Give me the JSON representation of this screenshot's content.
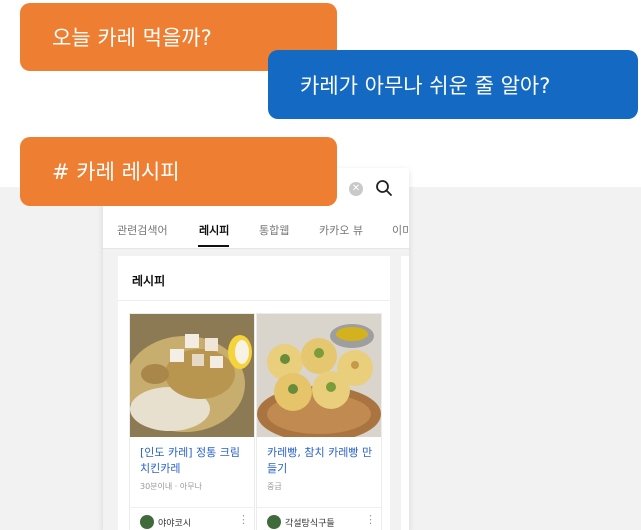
{
  "colors": {
    "orange_bubble": "#ee7e31",
    "blue_bubble": "#1469c2",
    "link_blue": "#2a62c8"
  },
  "bubbles": {
    "first": "오늘 카레 먹을까?",
    "second": "카레가 아무나 쉬운 줄 알아?",
    "third": "# 카레 레시피"
  },
  "search": {
    "clear_icon": "clear-icon",
    "search_icon": "search-icon"
  },
  "tabs": [
    {
      "label": "관련검색어"
    },
    {
      "label": "레시피",
      "active": true
    },
    {
      "label": "통합웹"
    },
    {
      "label": "카카오 뷰"
    },
    {
      "label": "이미"
    }
  ],
  "card": {
    "title": "레시피",
    "recipes": [
      {
        "title": "[인도 카레] 정통 크림 치킨카레",
        "meta": "30분이내 · 아무나",
        "author": "야야코시",
        "image": "chicken-curry-image"
      },
      {
        "title": "카레빵, 참치 카레빵 만들기",
        "meta": "중급",
        "author": "각설탕식구들",
        "image": "curry-bread-image"
      }
    ]
  }
}
